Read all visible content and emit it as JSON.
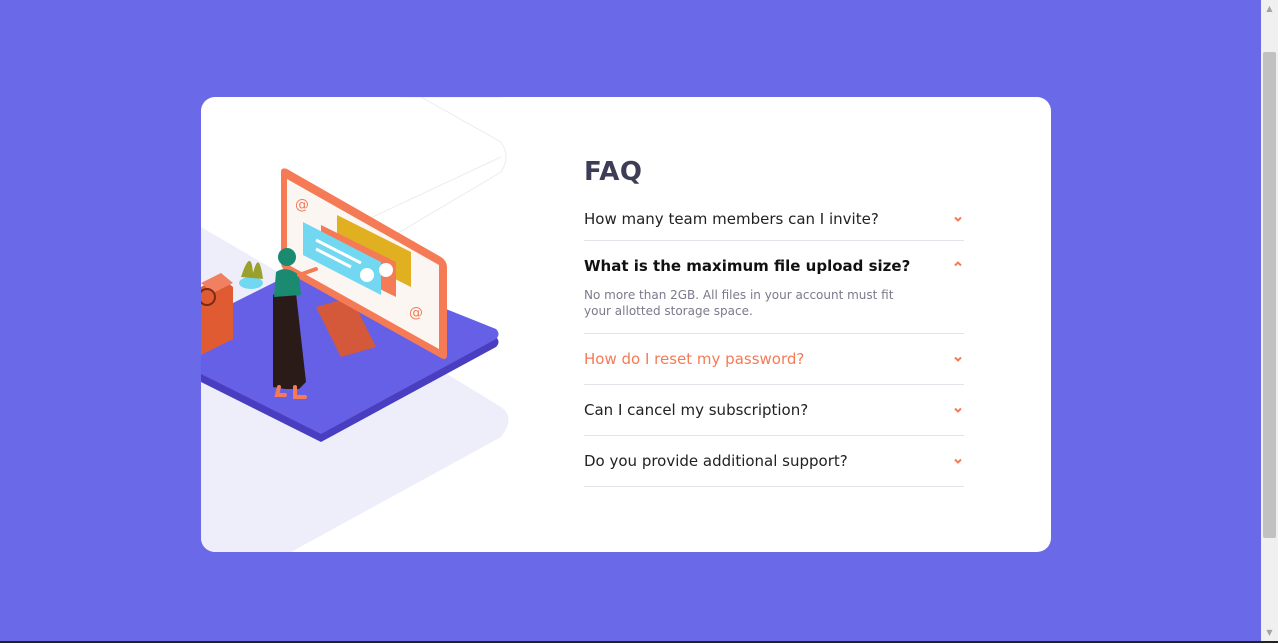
{
  "colors": {
    "background": "#6a6ae8",
    "card": "#ffffff",
    "accent": "#f47b56",
    "title": "#3d3d56"
  },
  "faq": {
    "title": "FAQ",
    "items": [
      {
        "question": "How many team members can I invite?",
        "open": false,
        "icon": "chevron-down-icon"
      },
      {
        "question": "What is the maximum file upload size?",
        "answer": "No more than 2GB. All files in your account must fit your allotted storage space.",
        "open": true,
        "icon": "chevron-up-icon"
      },
      {
        "question": "How do I reset my password?",
        "open": false,
        "hover": true,
        "icon": "chevron-down-icon"
      },
      {
        "question": "Can I cancel my subscription?",
        "open": false,
        "icon": "chevron-down-icon"
      },
      {
        "question": "Do you provide additional support?",
        "open": false,
        "icon": "chevron-down-icon"
      }
    ]
  }
}
